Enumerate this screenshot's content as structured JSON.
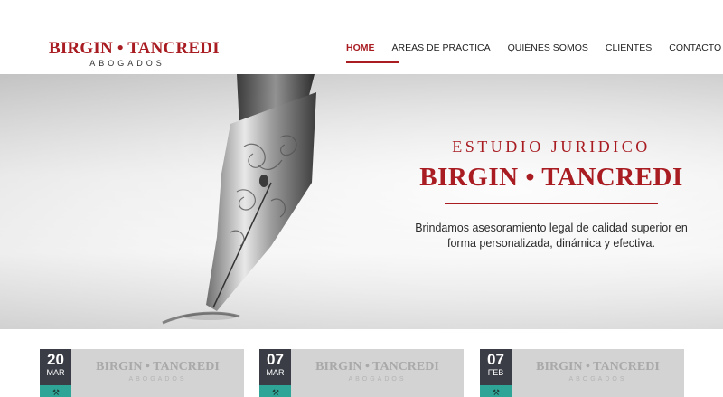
{
  "header": {
    "logo": {
      "main": "BIRGIN • TANCREDI",
      "sub": "ABOGADOS"
    },
    "nav": [
      {
        "label": "HOME",
        "active": true
      },
      {
        "label": "ÁREAS DE PRÁCTICA",
        "active": false
      },
      {
        "label": "QUIÉNES SOMOS",
        "active": false
      },
      {
        "label": "CLIENTES",
        "active": false
      },
      {
        "label": "CONTACTO",
        "active": false
      }
    ]
  },
  "hero": {
    "kicker": "ESTUDIO JURIDICO",
    "title": "BIRGIN • TANCREDI",
    "description": "Brindamos asesoramiento legal de calidad superior en forma personalizada, dinámica y efectiva."
  },
  "cards": [
    {
      "day": "20",
      "month": "MAR",
      "logo_main": "BIRGIN • TANCREDI",
      "logo_sub": "ABOGADOS",
      "icon": "gavel-icon"
    },
    {
      "day": "07",
      "month": "MAR",
      "logo_main": "BIRGIN • TANCREDI",
      "logo_sub": "ABOGADOS",
      "icon": "gavel-icon"
    },
    {
      "day": "07",
      "month": "FEB",
      "logo_main": "BIRGIN • TANCREDI",
      "logo_sub": "ABOGADOS",
      "icon": "gavel-icon"
    }
  ],
  "colors": {
    "brand": "#a81c22",
    "date_bg": "#3a3d46",
    "tag_bg": "#2fa597",
    "card_bg": "#d3d3d3"
  }
}
